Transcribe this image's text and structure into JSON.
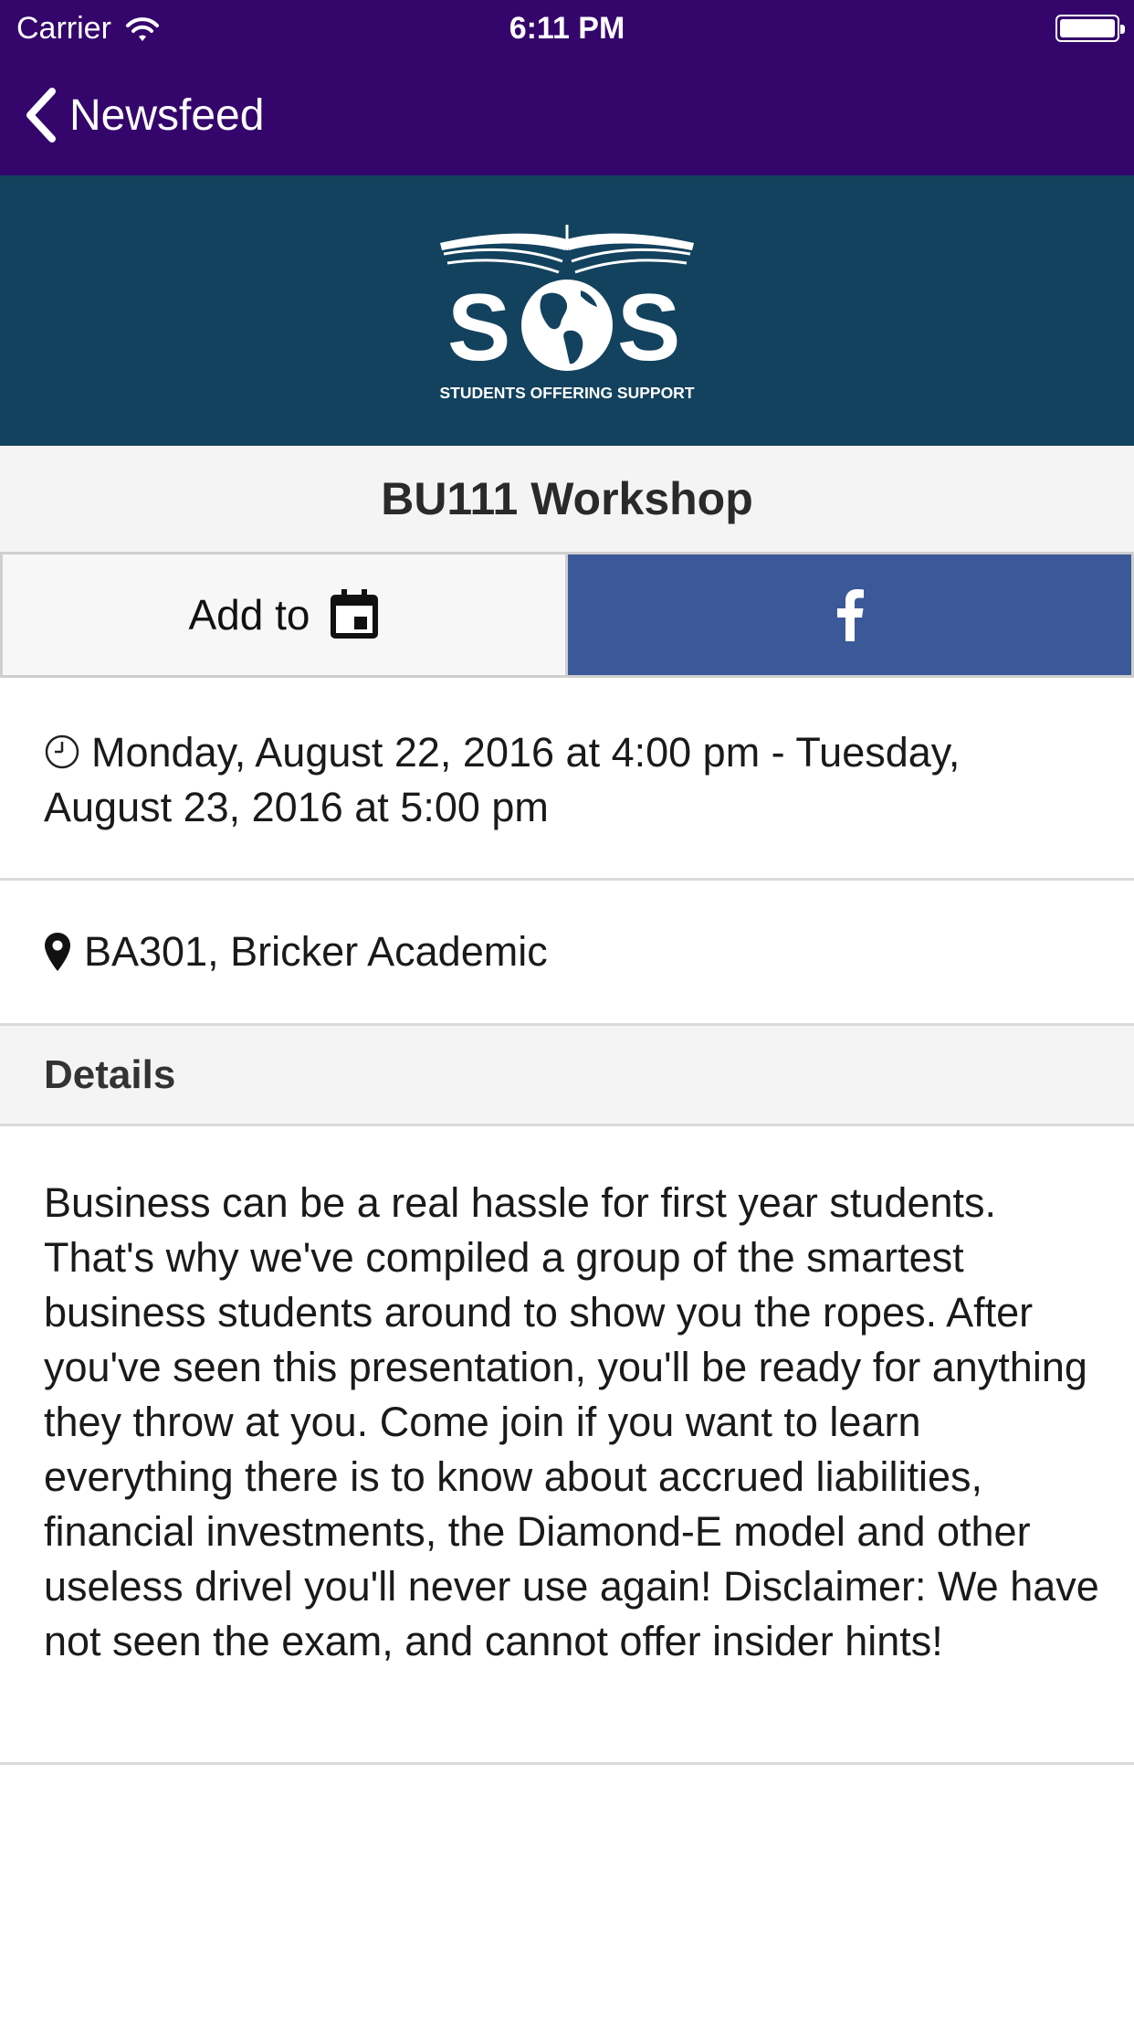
{
  "status_bar": {
    "carrier": "Carrier",
    "time": "6:11 PM"
  },
  "nav": {
    "back_label": "Newsfeed"
  },
  "banner": {
    "logo_text": "SOS",
    "logo_tagline": "STUDENTS OFFERING SUPPORT"
  },
  "event": {
    "title": "BU111 Workshop",
    "add_to_label": "Add to",
    "date_text": "Monday, August 22, 2016 at 4:00 pm - Tuesday, August 23, 2016 at 5:00 pm",
    "location": "BA301, Bricker Academic",
    "details_heading": "Details",
    "description": "Business can be a real hassle for first year students. That's why we've compiled a group of the smartest business students around to show you the ropes. After you've seen this presentation, you'll be ready for anything they throw at you. Come join if you want to learn everything there is to know about accrued liabilities, financial investments, the Diamond-E model and other useless drivel you'll never use again! Disclaimer: We have not seen the exam, and cannot offer insider hints!"
  },
  "colors": {
    "nav_background": "#34056b",
    "banner_background": "#13425e",
    "facebook_blue": "#3b5998"
  },
  "icons": {
    "back": "chevron-left-icon",
    "calendar": "calendar-icon",
    "facebook": "facebook-icon",
    "clock": "clock-icon",
    "location": "map-pin-icon"
  }
}
